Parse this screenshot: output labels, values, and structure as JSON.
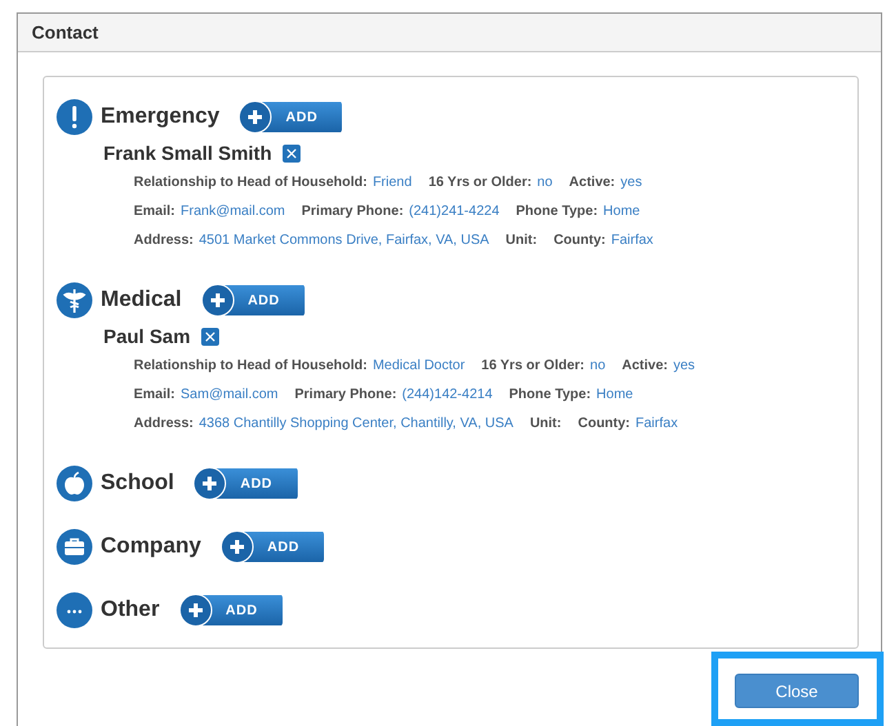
{
  "dialog": {
    "title": "Contact",
    "close_button": "Close"
  },
  "categories": [
    {
      "kind": "emergency",
      "label": "Emergency",
      "add_button": "ADD",
      "contacts": [
        {
          "name": "Frank Small Smith",
          "lines": [
            {
              "fields": [
                {
                  "label": "Relationship to Head of Household:",
                  "value": "Friend"
                },
                {
                  "label": "16 Yrs or Older:",
                  "value": "no"
                },
                {
                  "label": "Active:",
                  "value": "yes"
                }
              ]
            },
            {
              "fields": [
                {
                  "label": "Email:",
                  "value": "Frank@mail.com"
                },
                {
                  "label": "Primary Phone:",
                  "value": "(241)241-4224"
                },
                {
                  "label": "Phone Type:",
                  "value": "Home"
                }
              ]
            },
            {
              "fields": [
                {
                  "label": "Address:",
                  "value": "4501 Market Commons Drive, Fairfax, VA, USA"
                },
                {
                  "label": "Unit:"
                },
                {
                  "label": "County:",
                  "value": "Fairfax"
                }
              ]
            }
          ]
        }
      ]
    },
    {
      "kind": "medical",
      "label": "Medical",
      "add_button": "ADD",
      "contacts": [
        {
          "name": "Paul Sam",
          "lines": [
            {
              "fields": [
                {
                  "label": "Relationship to Head of Household:",
                  "value": "Medical Doctor"
                },
                {
                  "label": "16 Yrs or Older:",
                  "value": "no"
                },
                {
                  "label": "Active:",
                  "value": "yes"
                }
              ]
            },
            {
              "fields": [
                {
                  "label": "Email:",
                  "value": "Sam@mail.com"
                },
                {
                  "label": "Primary Phone:",
                  "value": "(244)142-4214"
                },
                {
                  "label": "Phone Type:",
                  "value": "Home"
                }
              ]
            },
            {
              "fields": [
                {
                  "label": "Address:",
                  "value": "4368 Chantilly Shopping Center, Chantilly, VA, USA"
                },
                {
                  "label": "Unit:"
                },
                {
                  "label": "County:",
                  "value": "Fairfax"
                }
              ]
            }
          ]
        }
      ]
    },
    {
      "kind": "school",
      "label": "School",
      "add_button": "ADD"
    },
    {
      "kind": "company",
      "label": "Company",
      "add_button": "ADD"
    },
    {
      "kind": "other",
      "label": "Other",
      "add_button": "ADD"
    }
  ]
}
